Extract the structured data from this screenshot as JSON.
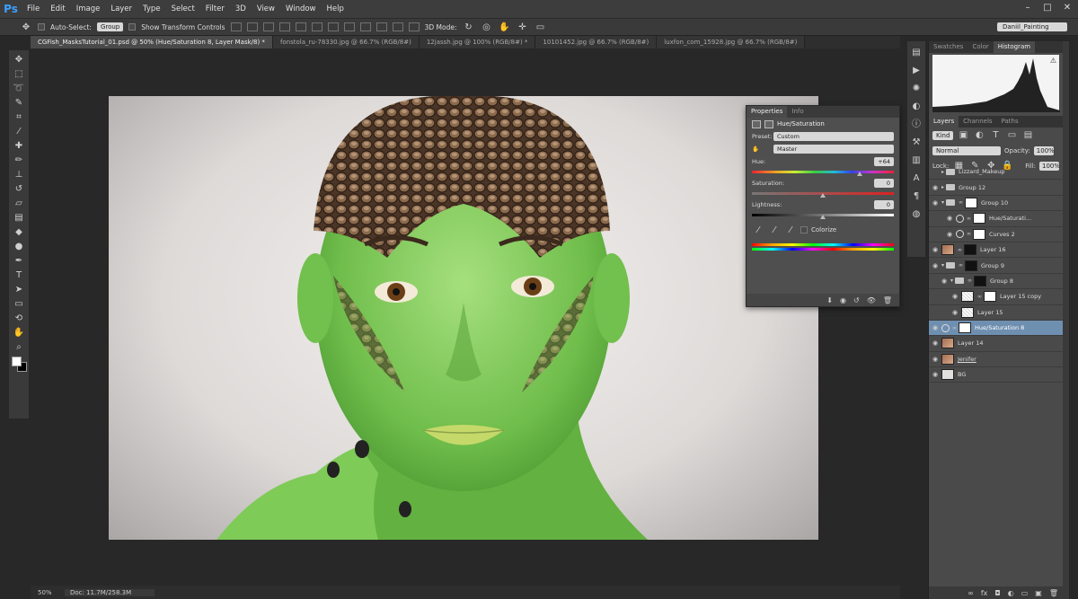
{
  "app": {
    "logo": "Ps"
  },
  "menu": [
    "File",
    "Edit",
    "Image",
    "Layer",
    "Type",
    "Select",
    "Filter",
    "3D",
    "View",
    "Window",
    "Help"
  ],
  "window_buttons": [
    "–",
    "□",
    "✕"
  ],
  "options": {
    "auto_select_label": "Auto-Select:",
    "auto_select_value": "Group",
    "show_transform_label": "Show Transform Controls",
    "mode_3d_label": "3D Mode:",
    "workspace": "Daniil_Painting"
  },
  "tabs": [
    {
      "label": "CGFish_MasksTutorial_01.psd @ 50% (Hue/Saturation 8, Layer Mask/8) *",
      "active": true
    },
    {
      "label": "fonstola_ru-78330.jpg @ 66.7% (RGB/8#)",
      "active": false
    },
    {
      "label": "12jassh.jpg @ 100% (RGB/8#) *",
      "active": false
    },
    {
      "label": "10101452.jpg @ 66.7% (RGB/8#)",
      "active": false
    },
    {
      "label": "luxfon_com_15928.jpg @ 66.7% (RGB/8#)",
      "active": false
    }
  ],
  "status": {
    "zoom": "50%",
    "doc": "Doc: 11.7M/258.3M"
  },
  "right_panel_tabs": [
    "Swatches",
    "Color",
    "Histogram"
  ],
  "layers_tabs": [
    "Layers",
    "Channels",
    "Paths"
  ],
  "layers_controls": {
    "filter": "Kind",
    "blend": "Normal",
    "opacity_label": "Opacity:",
    "opacity": "100%",
    "lock_label": "Lock:",
    "fill_label": "Fill:",
    "fill": "100%"
  },
  "layers": [
    {
      "name": "Lizzard_Makeup",
      "kind": "group",
      "indent": 0,
      "eye": false
    },
    {
      "name": "Group 12",
      "kind": "group",
      "indent": 0,
      "eye": true
    },
    {
      "name": "Group 10",
      "kind": "group-mask",
      "indent": 0,
      "eye": true
    },
    {
      "name": "Hue/Saturati...",
      "kind": "adj",
      "indent": 1,
      "eye": true
    },
    {
      "name": "Curves 2",
      "kind": "adj",
      "indent": 1,
      "eye": true
    },
    {
      "name": "Layer 16",
      "kind": "pixel-mask",
      "indent": 0,
      "eye": true
    },
    {
      "name": "Group 9",
      "kind": "group-mask-k",
      "indent": 0,
      "eye": true
    },
    {
      "name": "Group 8",
      "kind": "group-mask-k",
      "indent": 1,
      "eye": true
    },
    {
      "name": "Layer 15 copy",
      "kind": "pixel-mask-w",
      "indent": 2,
      "eye": true
    },
    {
      "name": "Layer 15",
      "kind": "pixel",
      "indent": 2,
      "eye": true
    },
    {
      "name": "Hue/Saturation 8",
      "kind": "adj",
      "indent": 0,
      "eye": true,
      "selected": true
    },
    {
      "name": "Layer 14",
      "kind": "pixel",
      "indent": 0,
      "eye": true
    },
    {
      "name": "Jenifer",
      "kind": "face",
      "indent": 0,
      "eye": true
    },
    {
      "name": "BG",
      "kind": "bg",
      "indent": 0,
      "eye": true
    }
  ],
  "properties": {
    "tabs": [
      "Properties",
      "Info"
    ],
    "title": "Hue/Saturation",
    "preset_label": "Preset:",
    "preset": "Custom",
    "channel": "Master",
    "hue_label": "Hue:",
    "hue": "+64",
    "hue_level": 0.76,
    "saturation_label": "Saturation:",
    "saturation": "0",
    "saturation_level": 0.5,
    "lightness_label": "Lightness:",
    "lightness": "0",
    "lightness_level": 0.5,
    "colorize_label": "Colorize"
  }
}
